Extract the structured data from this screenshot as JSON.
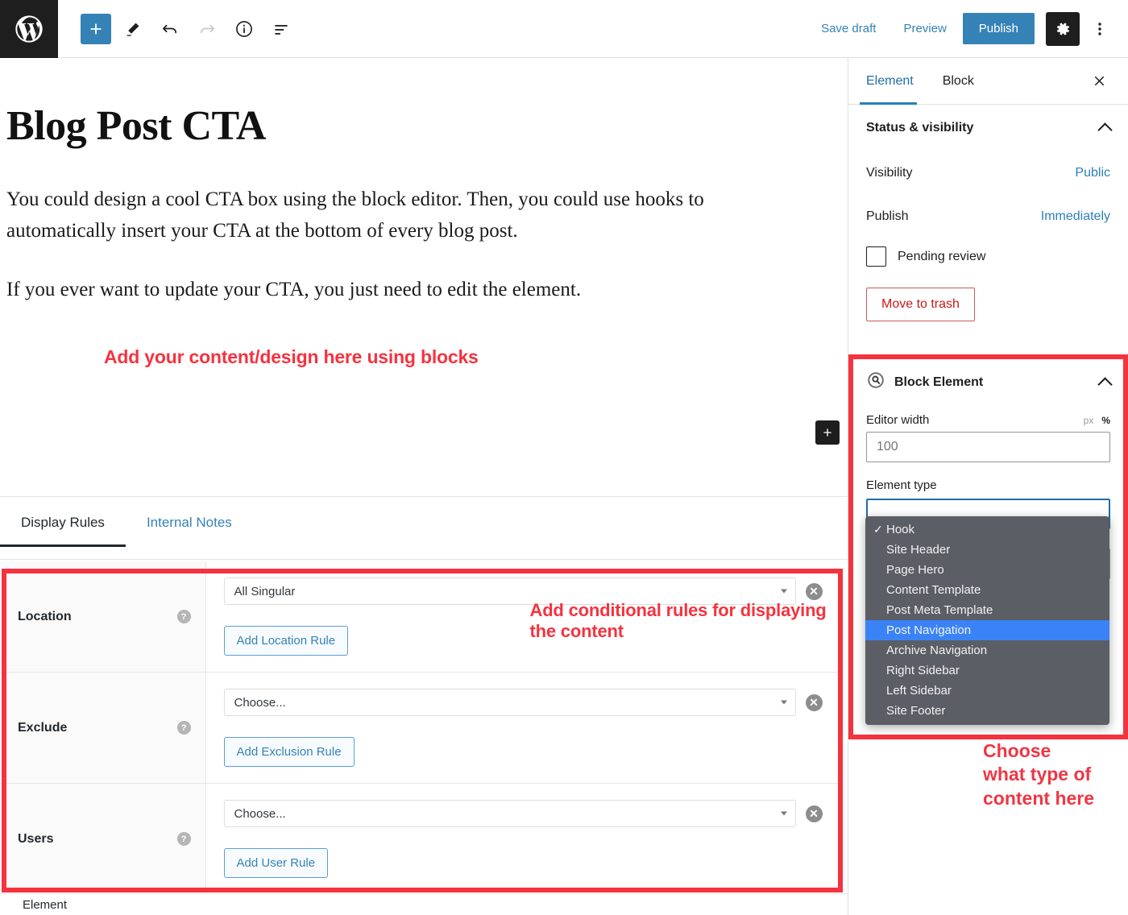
{
  "topbar": {
    "logo_icon": "wordpress-logo-icon",
    "tools": [
      {
        "name": "add-block-button",
        "icon": "plus-icon"
      },
      {
        "name": "edit-tool-button",
        "icon": "pencil-icon"
      },
      {
        "name": "undo-button",
        "icon": "undo-arrow-icon"
      },
      {
        "name": "redo-button",
        "icon": "redo-arrow-icon"
      },
      {
        "name": "details-button",
        "icon": "info-circle-icon"
      },
      {
        "name": "list-view-button",
        "icon": "list-view-icon"
      }
    ],
    "save_draft_label": "Save draft",
    "preview_label": "Preview",
    "publish_label": "Publish",
    "settings_icon": "gear-icon",
    "more_icon": "kebab-menu-icon",
    "accent_blue": "#3582b6"
  },
  "editor": {
    "title": "Blog Post CTA",
    "paragraph_1": "You could design a cool CTA box using the block editor. Then, you could use hooks to automatically insert your CTA at the bottom of every blog post.",
    "paragraph_2": "If you ever want to update your CTA, you just need to edit the element.",
    "annotation_blocks": "Add your content/design here using blocks",
    "inserter_icon": "plus-icon"
  },
  "tabs": {
    "items": [
      {
        "label": "Display Rules",
        "active": true
      },
      {
        "label": "Internal Notes",
        "active": false
      }
    ]
  },
  "rules": {
    "annotation": "Add conditional rules for displaying the content",
    "rows": [
      {
        "label": "Location",
        "help_icon": "question-mark-icon",
        "select_value": "All Singular",
        "clear_icon": "clear-circle-icon",
        "button_label": "Add Location Rule"
      },
      {
        "label": "Exclude",
        "help_icon": "question-mark-icon",
        "select_value": "Choose...",
        "clear_icon": "clear-circle-icon",
        "button_label": "Add Exclusion Rule"
      },
      {
        "label": "Users",
        "help_icon": "question-mark-icon",
        "select_value": "Choose...",
        "clear_icon": "clear-circle-icon",
        "button_label": "Add User Rule"
      }
    ]
  },
  "footer": {
    "label": "Element"
  },
  "sidebar": {
    "tabs": [
      {
        "label": "Element",
        "active": true
      },
      {
        "label": "Block",
        "active": false
      }
    ],
    "close_icon": "close-x-icon",
    "status_panel": {
      "title": "Status & visibility",
      "collapse_icon": "chevron-up-icon",
      "visibility_label": "Visibility",
      "visibility_value": "Public",
      "publish_label": "Publish",
      "publish_value": "Immediately",
      "pending_label": "Pending review",
      "pending_checked": false,
      "trash_label": "Move to trash"
    },
    "block_element_panel": {
      "icon": "block-element-icon",
      "title": "Block Element",
      "collapse_icon": "chevron-up-icon",
      "editor_width_label": "Editor width",
      "unit_px": "px",
      "unit_percent": "%",
      "active_unit": "%",
      "editor_width_value": "100",
      "element_type_label": "Element type",
      "element_type_options": [
        {
          "label": "Hook",
          "checked": true,
          "highlighted": false
        },
        {
          "label": "Site Header",
          "checked": false,
          "highlighted": false
        },
        {
          "label": "Page Hero",
          "checked": false,
          "highlighted": false
        },
        {
          "label": "Content Template",
          "checked": false,
          "highlighted": false
        },
        {
          "label": "Post Meta Template",
          "checked": false,
          "highlighted": false
        },
        {
          "label": "Post Navigation",
          "checked": false,
          "highlighted": true
        },
        {
          "label": "Archive Navigation",
          "checked": false,
          "highlighted": false
        },
        {
          "label": "Right Sidebar",
          "checked": false,
          "highlighted": false
        },
        {
          "label": "Left Sidebar",
          "checked": false,
          "highlighted": false
        },
        {
          "label": "Site Footer",
          "checked": false,
          "highlighted": false
        }
      ]
    },
    "annotation_choose": "Choose\nwhat type of\ncontent here"
  },
  "colors": {
    "annotation_red": "#f5333f",
    "highlight_blue": "#3a83f7",
    "dropdown_bg": "#5b5e65",
    "link_blue": "#3582b6"
  }
}
